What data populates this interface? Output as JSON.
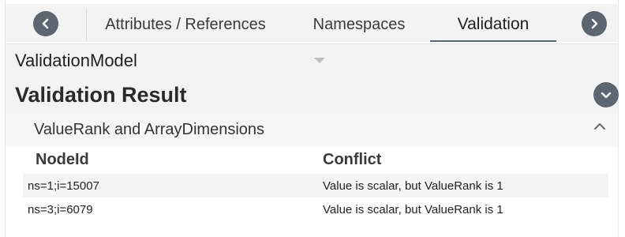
{
  "tabs": {
    "prev_icon": "chevron-left-icon",
    "next_icon": "chevron-right-icon",
    "items": [
      {
        "label": "Attributes / References"
      },
      {
        "label": "Namespaces"
      },
      {
        "label": "Validation",
        "active": true
      }
    ]
  },
  "model": {
    "label": "ValidationModel",
    "dropdown_icon": "caret-down-icon"
  },
  "result": {
    "title": "Validation Result",
    "collapse_icon": "chevron-down-icon"
  },
  "section": {
    "title": "ValueRank and ArrayDimensions",
    "toggle_icon": "chevron-up-icon"
  },
  "table": {
    "columns": [
      "NodeId",
      "Conflict"
    ],
    "rows": [
      {
        "node_id": "ns=1;i=15007",
        "conflict": "Value is scalar, but ValueRank is 1"
      },
      {
        "node_id": "ns=3;i=6079",
        "conflict": "Value is scalar, but ValueRank is 1"
      }
    ]
  },
  "colors": {
    "accent": "#5b6670",
    "panel": "#f3f3f3",
    "row_alt": "#f4f4f4"
  }
}
